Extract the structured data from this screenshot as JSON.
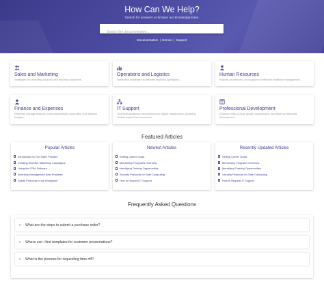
{
  "hero": {
    "title": "How Can We Help?",
    "subtitle": "Search for answers or browse our knowledge base.",
    "search_placeholder": "Search the documentation...",
    "links": [
      "Documentation",
      "Demos",
      "Support"
    ],
    "link_separator": "|"
  },
  "categories": [
    {
      "icon": "users-icon",
      "title": "Sales and Marketing",
      "desc": "Strategies for promoting products and reaching customers."
    },
    {
      "icon": "bar-chart-icon",
      "title": "Operations and Logistics",
      "desc": "Streamline processes for efficient business operations."
    },
    {
      "icon": "person-icon",
      "title": "Human Resources",
      "desc": "Policies, procedures, and support for effective workforce management."
    },
    {
      "icon": "person-icon",
      "title": "Finance and Expenses",
      "desc": "Efficiently manage finances, track expenditures accurately, and optimize budgets."
    },
    {
      "icon": "network-icon",
      "title": "IT Support",
      "desc": "Technical assistance and solutions for digital infrastructure, providing reliable support and resources."
    },
    {
      "icon": "book-icon",
      "title": "Professional Development",
      "desc": "Enhance skills, pursue growth opportunities, and foster professional development."
    }
  ],
  "featured": {
    "title": "Featured Articles",
    "columns": [
      {
        "title": "Popular Articles",
        "items": [
          "Introduction to Our Sales Process",
          "Creating Effective Marketing Campaigns",
          "Using the CRM Software",
          "Inventory Management Best Practices",
          "Safety Protocols in the Workplace"
        ]
      },
      {
        "title": "Newest Articles",
        "items": [
          "Setting Career Goals",
          "Mentorship Programs Overview",
          "Identifying Training Opportunities",
          "Security Protocols for Safe Computing",
          "How to Request IT Support"
        ]
      },
      {
        "title": "Recently Updated Articles",
        "items": [
          "Setting Career Goals",
          "Mentorship Programs Overview",
          "Identifying Training Opportunities",
          "Security Protocols for Safe Computing",
          "How to Request IT Support"
        ]
      }
    ]
  },
  "faq": {
    "title": "Frequently Asked Questions",
    "items": [
      "What are the steps to submit a purchase order?",
      "Where can I find templates for customer presentations?",
      "What is the process for requesting time off?"
    ]
  },
  "colors": {
    "accent": "#3e3d8f",
    "hero_bg": "#4d4ca3"
  }
}
